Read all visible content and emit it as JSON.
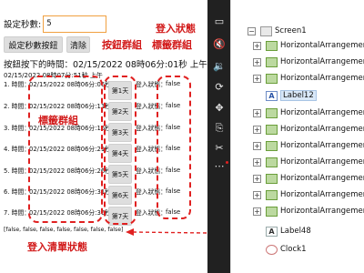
{
  "viewer": {
    "seconds_label": "設定秒數:",
    "seconds_value": "5",
    "set_button_label": "設定秒數按鈕",
    "clear_button_label": "清除",
    "press_time": "按鈕按下的時間：02/15/2022 08時06分:01秒 上午",
    "small_time": "02/15/2022 08時07分:51秒 上午",
    "rows": [
      {
        "label": "1. 時間：",
        "time": "02/15/2022 08時06分:06秒"
      },
      {
        "label": "2. 時間：",
        "time": "02/15/2022 08時06分:11秒"
      },
      {
        "label": "3. 時間：",
        "time": "02/15/2022 08時06分:16秒"
      },
      {
        "label": "4. 時間：",
        "time": "02/15/2022 08時06分:21秒"
      },
      {
        "label": "5. 時間：",
        "time": "02/15/2022 08時06分:26秒"
      },
      {
        "label": "6. 時間：",
        "time": "02/15/2022 08時06分:31秒"
      },
      {
        "label": "7. 時間：",
        "time": "02/15/2022 08時06分:36秒"
      }
    ],
    "day_buttons": [
      "第1天",
      "第2天",
      "第3天",
      "第4天",
      "第5天",
      "第6天",
      "第7天"
    ],
    "login_label": "登入狀態：",
    "login_values": [
      "false",
      "false",
      "false",
      "false",
      "false",
      "false",
      "false"
    ],
    "list_state": "[false, false, false, false, false, false, false]"
  },
  "annotations": {
    "login_state": "登入狀態",
    "button_group": "按鈕群組",
    "label_group_top": "標籤群組",
    "label_group_left": "標籤群組",
    "list_state": "登入清單狀態"
  },
  "toolbar": {
    "icons": [
      "tablet-icon",
      "volume-mute-icon",
      "volume-low-icon",
      "rotate-icon",
      "pan-icon",
      "copy-icon",
      "scissors-icon",
      "more-icon"
    ]
  },
  "tree": {
    "screen_label": "Screen1",
    "arrangement_label": "HorizontalArrangemen",
    "label12": "Label12",
    "label48": "Label48",
    "clock_label": "Clock1"
  },
  "colors": {
    "annotation": "#d21a1a",
    "toolbar_bg": "#212121",
    "input_border": "#f0a040",
    "tree_icon": "#bcd9a0"
  }
}
